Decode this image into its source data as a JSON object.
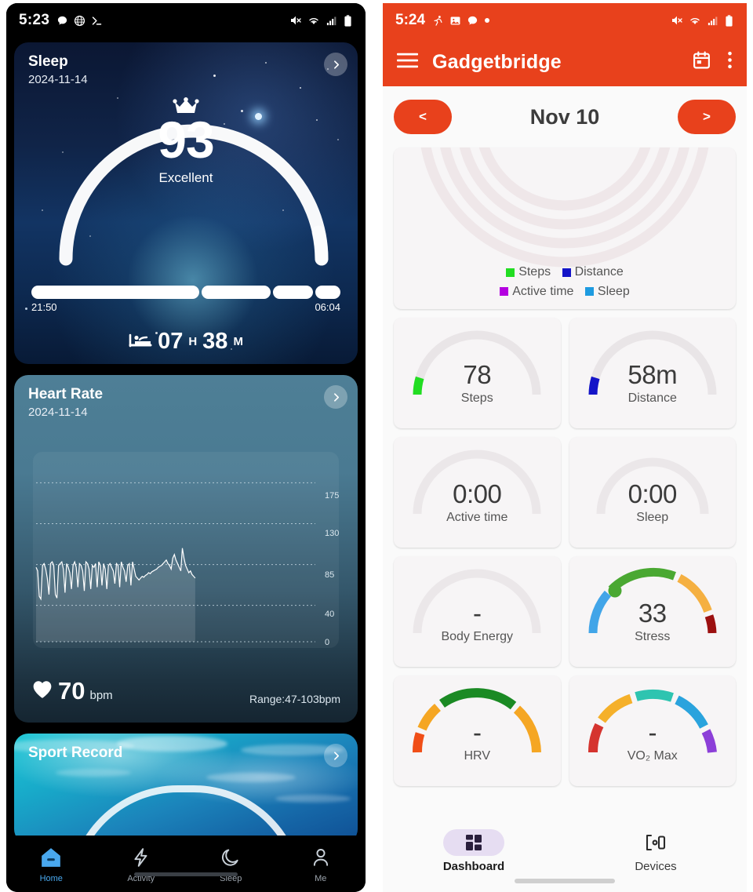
{
  "left_phone": {
    "status_bar": {
      "time": "5:23",
      "left_icons": [
        "message-bubble-icon",
        "browser-globe-icon",
        "terminal-icon"
      ],
      "right_icons": [
        "mute-icon",
        "wifi-icon",
        "cellular-signal-icon",
        "battery-icon"
      ]
    },
    "sleep_card": {
      "title": "Sleep",
      "date": "2024-11-14",
      "score": "93",
      "score_label": "Excellent",
      "crown_icon": "crown-icon",
      "bed_icon": "bed-icon",
      "start_time": "21:50",
      "end_time": "06:04",
      "duration_hours": "07",
      "duration_hours_unit": "H",
      "duration_minutes": "38",
      "duration_minutes_unit": "M",
      "arrow_icon": "chevron-right-icon",
      "segments": [
        54,
        22,
        13,
        8
      ]
    },
    "heart_rate_card": {
      "title": "Heart Rate",
      "date": "2024-11-14",
      "value": "70",
      "unit": "bpm",
      "range": "Range:47-103bpm",
      "heart_icon": "heart-icon",
      "arrow_icon": "chevron-right-icon"
    },
    "sport_card": {
      "title": "Sport Record",
      "arrow_icon": "chevron-right-icon"
    },
    "bottom_nav": [
      {
        "label": "Home",
        "icon": "home-icon",
        "active": true
      },
      {
        "label": "Activity",
        "icon": "lightning-bolt-icon",
        "active": false
      },
      {
        "label": "Sleep",
        "icon": "moon-icon",
        "active": false
      },
      {
        "label": "Me",
        "icon": "person-icon",
        "active": false
      }
    ]
  },
  "right_phone": {
    "status_bar": {
      "time": "5:24",
      "left_icons": [
        "running-icon",
        "image-icon",
        "message-bubble-icon",
        "dot-icon"
      ],
      "right_icons": [
        "mute-icon",
        "wifi-icon",
        "cellular-signal-icon",
        "battery-icon"
      ]
    },
    "app_bar": {
      "title": "Gadgetbridge",
      "menu_icon": "hamburger-menu-icon",
      "calendar_icon": "calendar-icon",
      "overflow_icon": "more-vertical-icon",
      "accent_color": "#e8411c"
    },
    "date_nav": {
      "prev_label": "<",
      "next_label": ">",
      "current_date": "Nov 10"
    },
    "legend": [
      {
        "label": "Steps",
        "color": "#22dd22"
      },
      {
        "label": "Distance",
        "color": "#1414c8"
      },
      {
        "label": "Active time",
        "color": "#b400e0"
      },
      {
        "label": "Sleep",
        "color": "#1e9be0"
      }
    ],
    "tiles": [
      {
        "name": "steps",
        "value": "78",
        "label": "Steps",
        "arc_color": "#22dd22",
        "fill": 0.03
      },
      {
        "name": "distance",
        "value": "58m",
        "label": "Distance",
        "arc_color": "#1414c8",
        "fill": 0.03
      },
      {
        "name": "active-time",
        "value": "0:00",
        "label": "Active time",
        "arc_color": "#e8e4e6",
        "fill": 0.0
      },
      {
        "name": "sleep",
        "value": "0:00",
        "label": "Sleep",
        "arc_color": "#e8e4e6",
        "fill": 0.0
      },
      {
        "name": "body-energy",
        "value": "-",
        "label": "Body Energy",
        "arc_color": "#e8e4e6",
        "fill": 0.0
      },
      {
        "name": "stress",
        "value": "33",
        "label": "Stress",
        "arc_color": "#4aa832",
        "fill": 0.33
      },
      {
        "name": "hrv",
        "value": "-",
        "label": "HRV",
        "arc_color": "#1b8a24",
        "fill": 0.0
      },
      {
        "name": "vo2max",
        "value": "-",
        "label": "VO₂ Max",
        "arc_color": "#2ec4b0",
        "fill": 0.0
      }
    ],
    "bottom_nav": [
      {
        "label": "Dashboard",
        "icon": "dashboard-grid-icon",
        "active": true
      },
      {
        "label": "Devices",
        "icon": "devices-icon",
        "active": false
      }
    ]
  },
  "chart_data": {
    "type": "line",
    "title": "Heart Rate",
    "xlabel": "",
    "ylabel": "bpm",
    "ylim": [
      0,
      190
    ],
    "yticks": [
      0,
      40,
      85,
      130,
      175
    ],
    "ytick_labels": [
      "0",
      "40",
      "85",
      "130",
      "175"
    ],
    "grid": true,
    "legend": "none",
    "series": [
      {
        "name": "Heart Rate",
        "unit": "bpm",
        "current": 70,
        "min": 47,
        "max": 103,
        "values": [
          82,
          78,
          50,
          47,
          84,
          86,
          80,
          70,
          52,
          86,
          88,
          84,
          52,
          48,
          84,
          86,
          88,
          80,
          54,
          86,
          82,
          76,
          58,
          84,
          88,
          82,
          60,
          86,
          84,
          78,
          56,
          88,
          86,
          80,
          58,
          84,
          82,
          86,
          60,
          88,
          84,
          62,
          86,
          80,
          58,
          84,
          86,
          82,
          78,
          64,
          86,
          84,
          60,
          88,
          82,
          78,
          66,
          84,
          86,
          62,
          88,
          80,
          72,
          70,
          68,
          70,
          72,
          71,
          73,
          74,
          76,
          75,
          77,
          78,
          79,
          80,
          82,
          83,
          84,
          86,
          88,
          90,
          86,
          84,
          80,
          92,
          96,
          90,
          86,
          82,
          78,
          103,
          92,
          84,
          80,
          76,
          78,
          74,
          72,
          70
        ]
      }
    ]
  }
}
